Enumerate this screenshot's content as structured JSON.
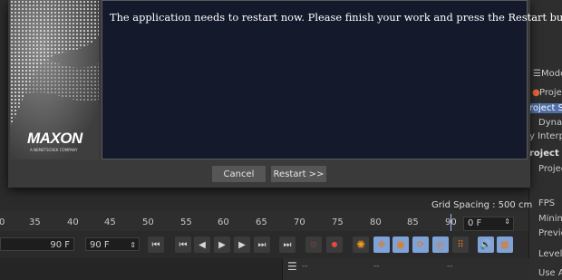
{
  "dialog": {
    "message": "The application needs to restart now. Please finish your work and press the Restart button.",
    "logo_text": "MAXON",
    "logo_subtext": "A NEMETSCHEK COMPANY",
    "cancel_label": "Cancel",
    "restart_label": "Restart >>"
  },
  "attributes": {
    "mode_label": "Mode",
    "rows": [
      "Project",
      "roject Se",
      "Dynam",
      "y Interp",
      "roject Se",
      "Project"
    ],
    "rows2": [
      "FPS",
      "Minim",
      "Previe",
      "Level o",
      "Use An"
    ]
  },
  "viewport": {
    "grid_spacing": "Grid Spacing : 500 cm"
  },
  "timeline": {
    "ticks": [
      "0",
      "35",
      "40",
      "45",
      "50",
      "55",
      "60",
      "65",
      "70",
      "75",
      "80",
      "85",
      "90"
    ],
    "current_frame": "0 F",
    "end_frame_left": "90 F",
    "end_frame_right": "90 F"
  },
  "bottom": {
    "dash1": "--",
    "dash2": "--",
    "dash3": "--"
  },
  "colors": {
    "accent": "#7fa2d8",
    "message_bg": "#141a2b",
    "record": "#e24a3a"
  }
}
